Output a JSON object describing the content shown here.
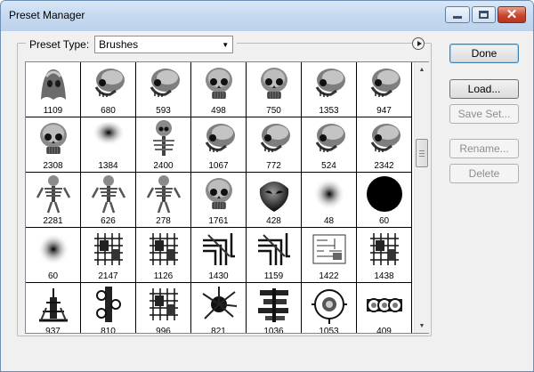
{
  "window": {
    "title": "Preset Manager"
  },
  "preset_type": {
    "label": "Preset Type:",
    "selected": "Brushes"
  },
  "buttons": {
    "done": "Done",
    "load": "Load...",
    "save_set": "Save Set...",
    "rename": "Rename...",
    "delete": "Delete"
  },
  "brush_sizes": [
    "1109",
    "680",
    "593",
    "498",
    "750",
    "1353",
    "947",
    "2308",
    "1384",
    "2400",
    "1067",
    "772",
    "524",
    "2342",
    "2281",
    "626",
    "278",
    "1761",
    "428",
    "48",
    "60",
    "60",
    "2147",
    "1126",
    "1430",
    "1159",
    "1422",
    "1438",
    "937",
    "810",
    "996",
    "821",
    "1036",
    "1053",
    "409"
  ],
  "brush_kinds": [
    "ghost-face",
    "skull-side",
    "skull-side",
    "skull-front",
    "skull-front",
    "skull-side",
    "skull-side",
    "skull-front",
    "shadow-blob",
    "skeleton-top",
    "skull-side",
    "skull-side",
    "skull-side",
    "skull-side",
    "skeleton",
    "skeleton",
    "skeleton",
    "skull-front",
    "alien-head",
    "soft-round",
    "hard-round",
    "soft-round",
    "machinery",
    "machinery",
    "pipes",
    "pipes",
    "circuits",
    "machinery",
    "tower",
    "gears",
    "machinery",
    "splatter",
    "stack",
    "gauge",
    "goggles"
  ]
}
